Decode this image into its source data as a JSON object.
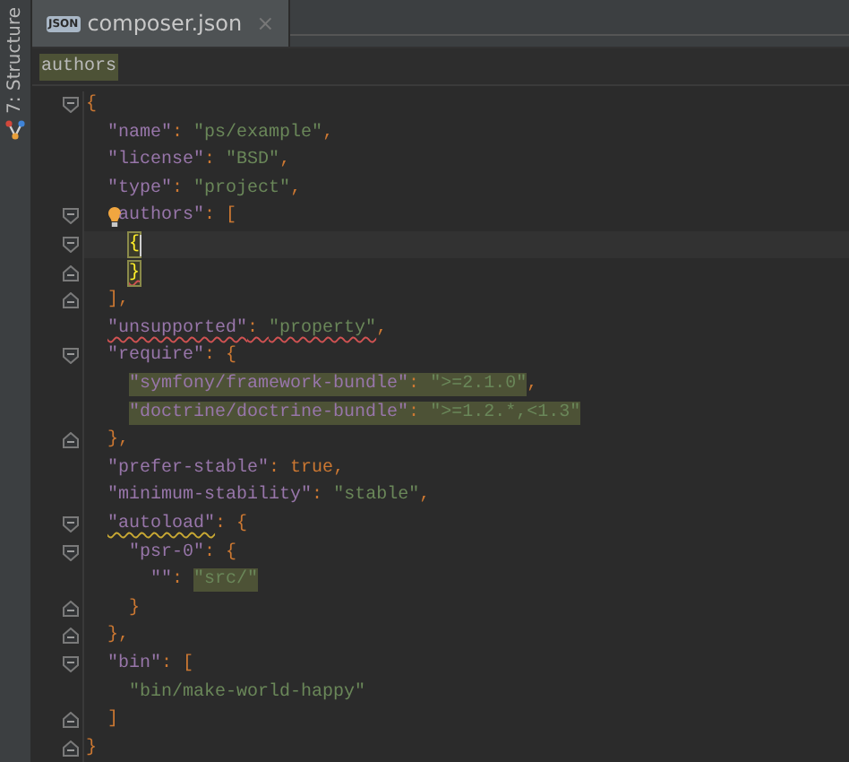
{
  "tool_stripe": {
    "label": "7: Structure"
  },
  "tab": {
    "label": "composer.json",
    "icon_text": "JSON",
    "close": "×",
    "selected": true
  },
  "breadcrumb": {
    "label": "authors",
    "selected": true
  },
  "lines": [
    {
      "fold_start": true,
      "tokens": [
        {
          "kind": "punct",
          "t": "{"
        }
      ]
    },
    {
      "tokens": [
        {
          "kind": "key",
          "t": "  \"name\""
        },
        {
          "kind": "punct",
          "t": ": "
        },
        {
          "kind": "string",
          "t": "\"ps/example\""
        },
        {
          "kind": "punct",
          "t": ","
        }
      ]
    },
    {
      "tokens": [
        {
          "kind": "key",
          "t": "  \"license\""
        },
        {
          "kind": "punct",
          "t": ": "
        },
        {
          "kind": "string",
          "t": "\"BSD\""
        },
        {
          "kind": "punct",
          "t": ","
        }
      ]
    },
    {
      "tokens": [
        {
          "kind": "key",
          "t": "  \"type\""
        },
        {
          "kind": "punct",
          "t": ": "
        },
        {
          "kind": "string",
          "t": "\"project\""
        },
        {
          "kind": "punct",
          "t": ","
        }
      ]
    },
    {
      "fold_start": true,
      "intention": true,
      "tokens": [
        {
          "kind": "key",
          "t": "  authors\""
        },
        {
          "kind": "punct",
          "t": ": ["
        }
      ]
    },
    {
      "fold_start": true,
      "current": true,
      "tokens": [
        {
          "kind": "punct",
          "t": "    {",
          "brace": true,
          "caret": true
        }
      ]
    },
    {
      "fold_end": true,
      "tokens": [
        {
          "kind": "punct",
          "t": "    }",
          "brace": true,
          "error": true
        }
      ]
    },
    {
      "fold_end": true,
      "tokens": [
        {
          "kind": "punct",
          "t": "  ],"
        }
      ]
    },
    {
      "tokens": [
        {
          "kind": "key",
          "t": "  \"unsupported\"",
          "error": true
        },
        {
          "kind": "punct",
          "t": ": ",
          "error": true
        },
        {
          "kind": "string",
          "t": "\"property\"",
          "error": true
        },
        {
          "kind": "punct",
          "t": ","
        }
      ]
    },
    {
      "fold_start": true,
      "tokens": [
        {
          "kind": "key",
          "t": "  \"require\""
        },
        {
          "kind": "punct",
          "t": ": {"
        }
      ]
    },
    {
      "tokens": [
        {
          "kind": "key",
          "t": "    \"symfony/framework-bundle\"",
          "highlight": true
        },
        {
          "kind": "punct",
          "t": ": ",
          "highlight": true
        },
        {
          "kind": "string",
          "t": "\">=2.1.0\"",
          "highlight": true
        },
        {
          "kind": "punct",
          "t": ","
        }
      ]
    },
    {
      "tokens": [
        {
          "kind": "key",
          "t": "    \"doctrine/doctrine-bundle\"",
          "highlight": true
        },
        {
          "kind": "punct",
          "t": ": ",
          "highlight": true
        },
        {
          "kind": "string",
          "t": "\">=1.2.*,<1.3\"",
          "highlight": true
        }
      ]
    },
    {
      "fold_end": true,
      "tokens": [
        {
          "kind": "punct",
          "t": "  },"
        }
      ]
    },
    {
      "tokens": [
        {
          "kind": "key",
          "t": "  \"prefer-stable\""
        },
        {
          "kind": "punct",
          "t": ": "
        },
        {
          "kind": "keyword",
          "t": "true"
        },
        {
          "kind": "punct",
          "t": ","
        }
      ]
    },
    {
      "tokens": [
        {
          "kind": "key",
          "t": "  \"minimum-stability\""
        },
        {
          "kind": "punct",
          "t": ": "
        },
        {
          "kind": "string",
          "t": "\"stable\""
        },
        {
          "kind": "punct",
          "t": ","
        }
      ]
    },
    {
      "fold_start": true,
      "tokens": [
        {
          "kind": "key",
          "t": "  \"autoload\"",
          "warning": true
        },
        {
          "kind": "punct",
          "t": ": {"
        }
      ]
    },
    {
      "fold_start": true,
      "tokens": [
        {
          "kind": "key",
          "t": "    \"psr-0\""
        },
        {
          "kind": "punct",
          "t": ": {"
        }
      ]
    },
    {
      "tokens": [
        {
          "kind": "key",
          "t": "      \"\""
        },
        {
          "kind": "punct",
          "t": ": "
        },
        {
          "kind": "string",
          "t": "\"src/\"",
          "highlight": true
        }
      ]
    },
    {
      "fold_end": true,
      "tokens": [
        {
          "kind": "punct",
          "t": "    }"
        }
      ]
    },
    {
      "fold_end": true,
      "tokens": [
        {
          "kind": "punct",
          "t": "  },"
        }
      ]
    },
    {
      "fold_start": true,
      "tokens": [
        {
          "kind": "key",
          "t": "  \"bin\""
        },
        {
          "kind": "punct",
          "t": ": ["
        }
      ]
    },
    {
      "tokens": [
        {
          "kind": "string",
          "t": "    \"bin/make-world-happy\""
        }
      ]
    },
    {
      "fold_end": true,
      "tokens": [
        {
          "kind": "punct",
          "t": "  ]"
        }
      ]
    },
    {
      "fold_end": true,
      "tokens": [
        {
          "kind": "punct",
          "t": "}"
        }
      ]
    }
  ]
}
